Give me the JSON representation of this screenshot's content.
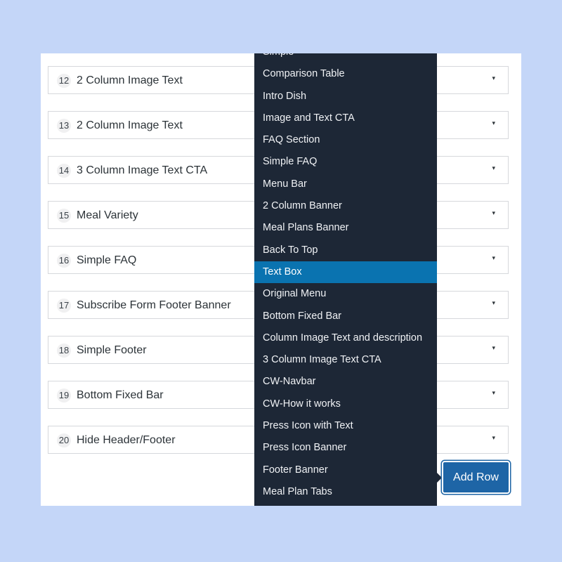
{
  "rows": [
    {
      "num": "12",
      "label": "2 Column Image Text"
    },
    {
      "num": "13",
      "label": "2 Column Image Text"
    },
    {
      "num": "14",
      "label": "3 Column Image Text CTA"
    },
    {
      "num": "15",
      "label": "Meal Variety"
    },
    {
      "num": "16",
      "label": "Simple FAQ"
    },
    {
      "num": "17",
      "label": "Subscribe Form Footer Banner"
    },
    {
      "num": "18",
      "label": "Simple Footer"
    },
    {
      "num": "19",
      "label": "Bottom Fixed Bar"
    },
    {
      "num": "20",
      "label": "Hide Header/Footer"
    }
  ],
  "caret": "▾",
  "dropdown": {
    "items": [
      "Simple",
      "Comparison Table",
      "Intro Dish",
      "Image and Text CTA",
      "FAQ Section",
      "Simple FAQ",
      "Menu Bar",
      "2 Column Banner",
      "Meal Plans Banner",
      "Back To Top",
      "Text Box",
      "Original Menu",
      "Bottom Fixed Bar",
      "Column Image Text and description",
      "3 Column Image Text CTA",
      "CW-Navbar",
      "CW-How it works",
      "Press Icon with Text",
      "Press Icon Banner",
      "Footer Banner",
      "Meal Plan Tabs"
    ],
    "selected": "Text Box"
  },
  "add_row_label": "Add Row",
  "colors": {
    "background": "#c4d6f8",
    "dropdown_bg": "#1d2736",
    "selected_bg": "#0a73b0",
    "button_bg": "#1e65a6"
  }
}
